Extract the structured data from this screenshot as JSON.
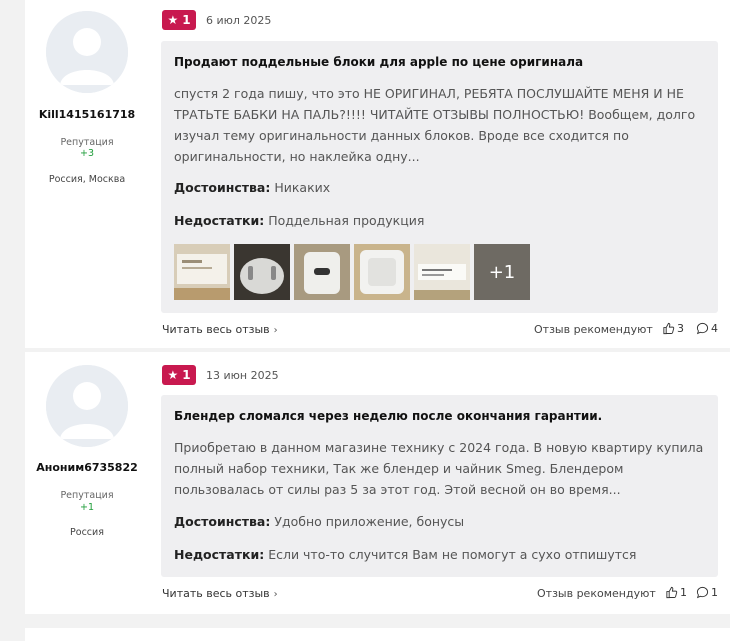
{
  "reviews": [
    {
      "author": "Kill1415161718",
      "reputation_label": "Репутация",
      "reputation_value": "+3",
      "location": "Россия, Москва",
      "rating": "1",
      "date": "6 июл 2025",
      "title": "Продают поддельные блоки для apple по цене оригинала",
      "text": "спустя 2 года пишу, что это НЕ ОРИГИНАЛ, РЕБЯТА ПОСЛУШАЙТЕ МЕНЯ И НЕ ТРАТЬТЕ БАБКИ НА ПАЛЬ?!!!! ЧИТАЙТЕ ОТЗЫВЫ ПОЛНОСТЬЮ! Вообщем, долго изучал тему оригинальности данных блоков. Вроде все сходится по оригинальности, но наклейка одну...",
      "pros_label": "Достоинства:",
      "pros": "Никаких",
      "cons_label": "Недостатки:",
      "cons": "Поддельная продукция",
      "photos_more": "+1",
      "read_more": "Читать весь отзыв",
      "recommend_label": "Отзыв рекомендуют",
      "likes": "3",
      "comments": "4"
    },
    {
      "author": "Аноним6735822",
      "reputation_label": "Репутация",
      "reputation_value": "+1",
      "location": "Россия",
      "rating": "1",
      "date": "13 июн 2025",
      "title": "Блендер сломался через неделю после окончания гарантии.",
      "text": "Приобретаю в данном магазине технику с 2024 года. В новую квартиру купила полный набор техники, Так же блендер и чайник Smeg. Блендером пользовалась от силы раз 5 за этот год. Этой весной он во время...",
      "pros_label": "Достоинства:",
      "pros": "Удобно приложение, бонусы",
      "cons_label": "Недостатки:",
      "cons": "Если что-то случится Вам не помогут а сухо отпишутся",
      "read_more": "Читать весь отзыв",
      "recommend_label": "Отзыв рекомендуют",
      "likes": "1",
      "comments": "1"
    }
  ],
  "colors": {
    "badge": "#c8194f",
    "reputation": "#1f9d3a",
    "body_bg": "#efeff1",
    "page_bg": "#f2f2f2"
  },
  "icons": [
    "avatar-placeholder-icon",
    "star-icon",
    "chevron-right-icon",
    "thumb-up-icon",
    "comment-icon"
  ]
}
